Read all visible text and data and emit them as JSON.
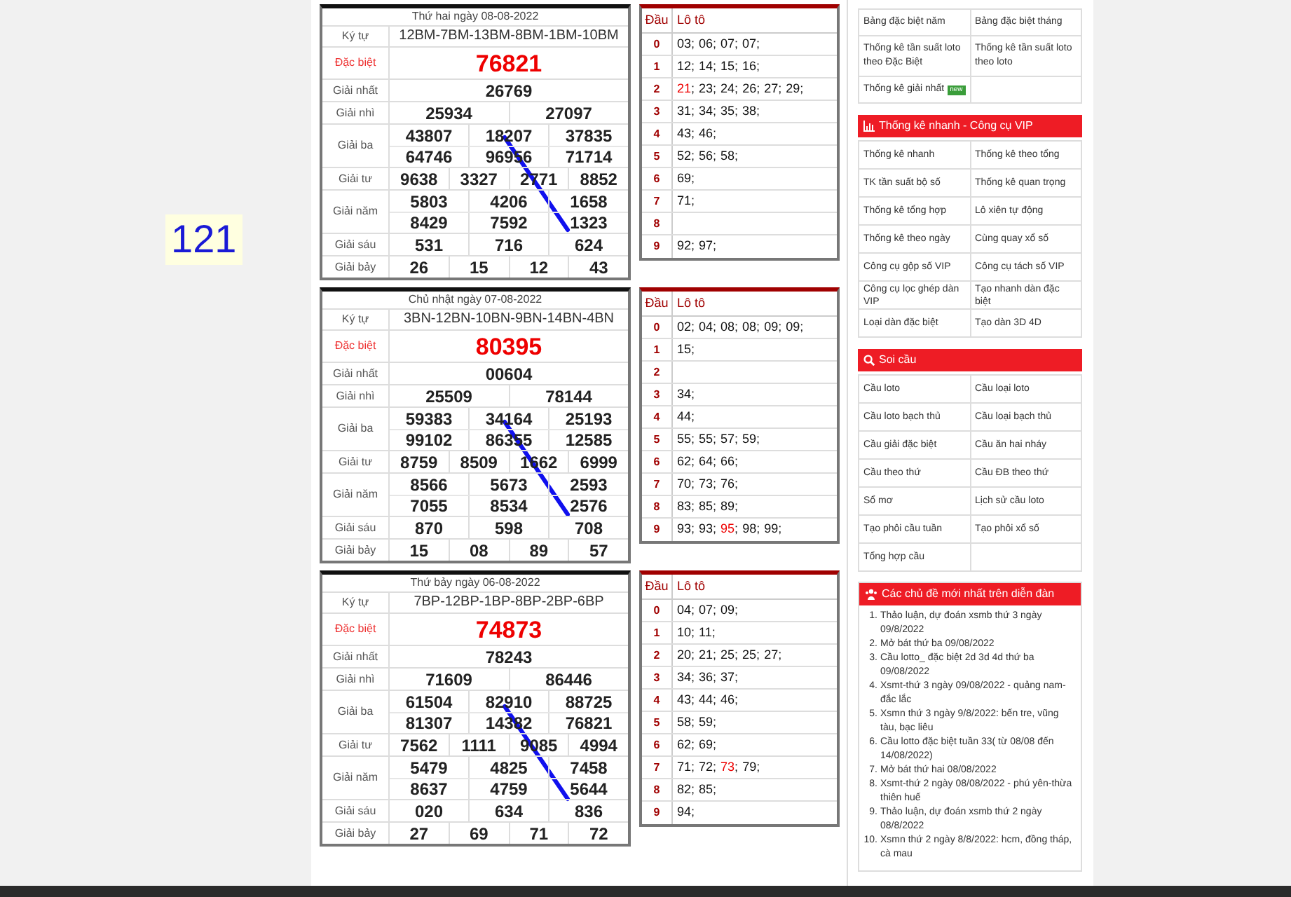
{
  "side_badge": {
    "text": "121"
  },
  "draws": [
    {
      "result": {
        "date": "Thứ hai ngày 08-08-2022",
        "rows": [
          {
            "label": "Ký tự",
            "kind": "code",
            "cells": [
              [
                "12BM-7BM-13BM-8BM-1BM-10BM"
              ]
            ]
          },
          {
            "label": "Đặc biệt",
            "kind": "special",
            "cells": [
              [
                "76821"
              ]
            ]
          },
          {
            "label": "Giải nhất",
            "kind": "prize",
            "cells": [
              [
                "26769"
              ]
            ]
          },
          {
            "label": "Giải nhì",
            "kind": "prize",
            "cells": [
              [
                "25934",
                "27097"
              ]
            ]
          },
          {
            "label": "Giải ba",
            "kind": "prize",
            "cells": [
              [
                "43807",
                "18207",
                "37835"
              ],
              [
                "64746",
                "96956",
                "71714"
              ]
            ]
          },
          {
            "label": "Giải tư",
            "kind": "prize",
            "cells": [
              [
                "9638",
                "3327",
                "2771",
                "8852"
              ]
            ]
          },
          {
            "label": "Giải năm",
            "kind": "prize",
            "cells": [
              [
                "5803",
                "4206",
                "1658"
              ],
              [
                "8429",
                "7592",
                "1323"
              ]
            ]
          },
          {
            "label": "Giải sáu",
            "kind": "prize",
            "cells": [
              [
                "531",
                "716",
                "624"
              ]
            ]
          },
          {
            "label": "Giải bảy",
            "kind": "prize",
            "cells": [
              [
                "26",
                "15",
                "12",
                "43"
              ]
            ]
          }
        ]
      },
      "loto": {
        "head": [
          "Đầu",
          "Lô tô"
        ],
        "rows": [
          {
            "digit": "0",
            "items": [
              {
                "text": "03;",
                "hit": false
              },
              {
                "text": "06;",
                "hit": false
              },
              {
                "text": "07;",
                "hit": false
              },
              {
                "text": "07;",
                "hit": false
              }
            ]
          },
          {
            "digit": "1",
            "items": [
              {
                "text": "12;",
                "hit": false
              },
              {
                "text": "14;",
                "hit": false
              },
              {
                "text": "15;",
                "hit": false
              },
              {
                "text": "16;",
                "hit": false
              }
            ]
          },
          {
            "digit": "2",
            "items": [
              {
                "text": "21",
                "hit": true
              },
              {
                "text": ";",
                "hit": false
              },
              {
                "text": "23;",
                "hit": false
              },
              {
                "text": "24;",
                "hit": false
              },
              {
                "text": "26;",
                "hit": false
              },
              {
                "text": "27;",
                "hit": false
              },
              {
                "text": "29;",
                "hit": false
              }
            ]
          },
          {
            "digit": "3",
            "items": [
              {
                "text": "31;",
                "hit": false
              },
              {
                "text": "34;",
                "hit": false
              },
              {
                "text": "35;",
                "hit": false
              },
              {
                "text": "38;",
                "hit": false
              }
            ]
          },
          {
            "digit": "4",
            "items": [
              {
                "text": "43;",
                "hit": false
              },
              {
                "text": "46;",
                "hit": false
              }
            ]
          },
          {
            "digit": "5",
            "items": [
              {
                "text": "52;",
                "hit": false
              },
              {
                "text": "56;",
                "hit": false
              },
              {
                "text": "58;",
                "hit": false
              }
            ]
          },
          {
            "digit": "6",
            "items": [
              {
                "text": "69;",
                "hit": false
              }
            ]
          },
          {
            "digit": "7",
            "items": [
              {
                "text": "71;",
                "hit": false
              }
            ]
          },
          {
            "digit": "8",
            "items": []
          },
          {
            "digit": "9",
            "items": [
              {
                "text": "92;",
                "hit": false
              },
              {
                "text": "97;",
                "hit": false
              }
            ]
          }
        ]
      }
    },
    {
      "result": {
        "date": "Chủ nhật ngày 07-08-2022",
        "rows": [
          {
            "label": "Ký tự",
            "kind": "code",
            "cells": [
              [
                "3BN-12BN-10BN-9BN-14BN-4BN"
              ]
            ]
          },
          {
            "label": "Đặc biệt",
            "kind": "special",
            "cells": [
              [
                "80395"
              ]
            ]
          },
          {
            "label": "Giải nhất",
            "kind": "prize",
            "cells": [
              [
                "00604"
              ]
            ]
          },
          {
            "label": "Giải nhì",
            "kind": "prize",
            "cells": [
              [
                "25509",
                "78144"
              ]
            ]
          },
          {
            "label": "Giải ba",
            "kind": "prize",
            "cells": [
              [
                "59383",
                "34164",
                "25193"
              ],
              [
                "99102",
                "86355",
                "12585"
              ]
            ]
          },
          {
            "label": "Giải tư",
            "kind": "prize",
            "cells": [
              [
                "8759",
                "8509",
                "1662",
                "6999"
              ]
            ]
          },
          {
            "label": "Giải năm",
            "kind": "prize",
            "cells": [
              [
                "8566",
                "5673",
                "2593"
              ],
              [
                "7055",
                "8534",
                "2576"
              ]
            ]
          },
          {
            "label": "Giải sáu",
            "kind": "prize",
            "cells": [
              [
                "870",
                "598",
                "708"
              ]
            ]
          },
          {
            "label": "Giải bảy",
            "kind": "prize",
            "cells": [
              [
                "15",
                "08",
                "89",
                "57"
              ]
            ]
          }
        ]
      },
      "loto": {
        "head": [
          "Đầu",
          "Lô tô"
        ],
        "rows": [
          {
            "digit": "0",
            "items": [
              {
                "text": "02;",
                "hit": false
              },
              {
                "text": "04;",
                "hit": false
              },
              {
                "text": "08;",
                "hit": false
              },
              {
                "text": "08;",
                "hit": false
              },
              {
                "text": "09;",
                "hit": false
              },
              {
                "text": "09;",
                "hit": false
              }
            ]
          },
          {
            "digit": "1",
            "items": [
              {
                "text": "15;",
                "hit": false
              }
            ]
          },
          {
            "digit": "2",
            "items": []
          },
          {
            "digit": "3",
            "items": [
              {
                "text": "34;",
                "hit": false
              }
            ]
          },
          {
            "digit": "4",
            "items": [
              {
                "text": "44;",
                "hit": false
              }
            ]
          },
          {
            "digit": "5",
            "items": [
              {
                "text": "55;",
                "hit": false
              },
              {
                "text": "55;",
                "hit": false
              },
              {
                "text": "57;",
                "hit": false
              },
              {
                "text": "59;",
                "hit": false
              }
            ]
          },
          {
            "digit": "6",
            "items": [
              {
                "text": "62;",
                "hit": false
              },
              {
                "text": "64;",
                "hit": false
              },
              {
                "text": "66;",
                "hit": false
              }
            ]
          },
          {
            "digit": "7",
            "items": [
              {
                "text": "70;",
                "hit": false
              },
              {
                "text": "73;",
                "hit": false
              },
              {
                "text": "76;",
                "hit": false
              }
            ]
          },
          {
            "digit": "8",
            "items": [
              {
                "text": "83;",
                "hit": false
              },
              {
                "text": "85;",
                "hit": false
              },
              {
                "text": "89;",
                "hit": false
              }
            ]
          },
          {
            "digit": "9",
            "items": [
              {
                "text": "93;",
                "hit": false
              },
              {
                "text": "93;",
                "hit": false
              },
              {
                "text": "95",
                "hit": true
              },
              {
                "text": ";",
                "hit": false
              },
              {
                "text": "98;",
                "hit": false
              },
              {
                "text": "99;",
                "hit": false
              }
            ]
          }
        ]
      }
    },
    {
      "result": {
        "date": "Thứ bảy ngày 06-08-2022",
        "rows": [
          {
            "label": "Ký tự",
            "kind": "code",
            "cells": [
              [
                "7BP-12BP-1BP-8BP-2BP-6BP"
              ]
            ]
          },
          {
            "label": "Đặc biệt",
            "kind": "special",
            "cells": [
              [
                "74873"
              ]
            ]
          },
          {
            "label": "Giải nhất",
            "kind": "prize",
            "cells": [
              [
                "78243"
              ]
            ]
          },
          {
            "label": "Giải nhì",
            "kind": "prize",
            "cells": [
              [
                "71609",
                "86446"
              ]
            ]
          },
          {
            "label": "Giải ba",
            "kind": "prize",
            "cells": [
              [
                "61504",
                "82910",
                "88725"
              ],
              [
                "81307",
                "14382",
                "76821"
              ]
            ]
          },
          {
            "label": "Giải tư",
            "kind": "prize",
            "cells": [
              [
                "7562",
                "1111",
                "9085",
                "4994"
              ]
            ]
          },
          {
            "label": "Giải năm",
            "kind": "prize",
            "cells": [
              [
                "5479",
                "4825",
                "7458"
              ],
              [
                "8637",
                "4759",
                "5644"
              ]
            ]
          },
          {
            "label": "Giải sáu",
            "kind": "prize",
            "cells": [
              [
                "020",
                "634",
                "836"
              ]
            ]
          },
          {
            "label": "Giải bảy",
            "kind": "prize",
            "cells": [
              [
                "27",
                "69",
                "71",
                "72"
              ]
            ]
          }
        ]
      },
      "loto": {
        "head": [
          "Đầu",
          "Lô tô"
        ],
        "rows": [
          {
            "digit": "0",
            "items": [
              {
                "text": "04;",
                "hit": false
              },
              {
                "text": "07;",
                "hit": false
              },
              {
                "text": "09;",
                "hit": false
              }
            ]
          },
          {
            "digit": "1",
            "items": [
              {
                "text": "10;",
                "hit": false
              },
              {
                "text": "11;",
                "hit": false
              }
            ]
          },
          {
            "digit": "2",
            "items": [
              {
                "text": "20;",
                "hit": false
              },
              {
                "text": "21;",
                "hit": false
              },
              {
                "text": "25;",
                "hit": false
              },
              {
                "text": "25;",
                "hit": false
              },
              {
                "text": "27;",
                "hit": false
              }
            ]
          },
          {
            "digit": "3",
            "items": [
              {
                "text": "34;",
                "hit": false
              },
              {
                "text": "36;",
                "hit": false
              },
              {
                "text": "37;",
                "hit": false
              }
            ]
          },
          {
            "digit": "4",
            "items": [
              {
                "text": "43;",
                "hit": false
              },
              {
                "text": "44;",
                "hit": false
              },
              {
                "text": "46;",
                "hit": false
              }
            ]
          },
          {
            "digit": "5",
            "items": [
              {
                "text": "58;",
                "hit": false
              },
              {
                "text": "59;",
                "hit": false
              }
            ]
          },
          {
            "digit": "6",
            "items": [
              {
                "text": "62;",
                "hit": false
              },
              {
                "text": "69;",
                "hit": false
              }
            ]
          },
          {
            "digit": "7",
            "items": [
              {
                "text": "71;",
                "hit": false
              },
              {
                "text": "72;",
                "hit": false
              },
              {
                "text": "73",
                "hit": true
              },
              {
                "text": ";",
                "hit": false
              },
              {
                "text": "79;",
                "hit": false
              }
            ]
          },
          {
            "digit": "8",
            "items": [
              {
                "text": "82;",
                "hit": false
              },
              {
                "text": "85;",
                "hit": false
              }
            ]
          },
          {
            "digit": "9",
            "items": [
              {
                "text": "94;",
                "hit": false
              }
            ]
          }
        ]
      }
    }
  ],
  "sidebar": {
    "top_links": [
      {
        "text": "Bảng đặc biệt năm"
      },
      {
        "text": "Bảng đặc biệt tháng"
      },
      {
        "text": "Thống kê tần suất loto theo Đặc Biệt"
      },
      {
        "text": "Thống kê tần suất loto theo loto"
      },
      {
        "text": "Thống kê giải nhất",
        "badge": "new"
      }
    ],
    "panels": [
      {
        "title": "Thống kê nhanh - Công cụ VIP",
        "kind": "chart",
        "links": [
          "Thống kê nhanh",
          "Thống kê theo tổng",
          "TK tần suất bộ số",
          "Thống kê quan trọng",
          "Thống kê tổng hợp",
          "Lô xiên tự động",
          "Thống kê theo ngày",
          "Cùng quay xổ số",
          "Công cụ gộp số VIP",
          "Công cụ tách số VIP",
          "Công cụ lọc ghép dàn VIP",
          "Tạo nhanh dàn đặc biệt",
          "Loại dàn đặc biệt",
          "Tạo dàn 3D 4D"
        ]
      },
      {
        "title": "Soi cầu",
        "kind": "search",
        "links": [
          "Cầu loto",
          "Cầu loại loto",
          "Cầu loto bạch thủ",
          "Cầu loại bạch thủ",
          "Cầu giải đặc biệt",
          "Cầu ăn hai nháy",
          "Cầu theo thứ",
          "Cầu ĐB theo thứ",
          "Sổ mơ",
          "Lịch sử cầu loto",
          "Tạo phôi cầu tuần",
          "Tạo phôi xổ số",
          "Tổng hợp cầu"
        ]
      }
    ],
    "forum": {
      "title": "Các chủ đề mới nhất trên diễn đàn",
      "topics": [
        {
          "num": "1.",
          "text": "Thảo luận, dự đoán xsmb thứ 3 ngày 09/8/2022"
        },
        {
          "num": "2.",
          "text": "Mở bát thứ ba 09/08/2022"
        },
        {
          "num": "3.",
          "text": "Cầu lotto_ đặc biệt 2d 3d 4d thứ ba 09/08/2022"
        },
        {
          "num": "4.",
          "text": "Xsmt-thứ 3 ngày 09/08/2022 - quảng nam-đắc lắc"
        },
        {
          "num": "5.",
          "text": "Xsmn thứ 3 ngày 9/8/2022: bến tre, vũng tàu, bạc liêu"
        },
        {
          "num": "6.",
          "text": "Cầu lotto đặc biệt tuần 33( từ 08/08 đến 14/08/2022)"
        },
        {
          "num": "7.",
          "text": "Mở bát thứ hai 08/08/2022"
        },
        {
          "num": "8.",
          "text": "Xsmt-thứ 2 ngày 08/08/2022 - phú yên-thừa thiên huế"
        },
        {
          "num": "9.",
          "text": "Thảo luận, dự đoán xsmb thứ 2 ngày 08/8/2022"
        },
        {
          "num": "10.",
          "text": "Xsmn thứ 2 ngày 8/8/2022: hcm, đồng tháp, cà mau"
        }
      ]
    }
  }
}
